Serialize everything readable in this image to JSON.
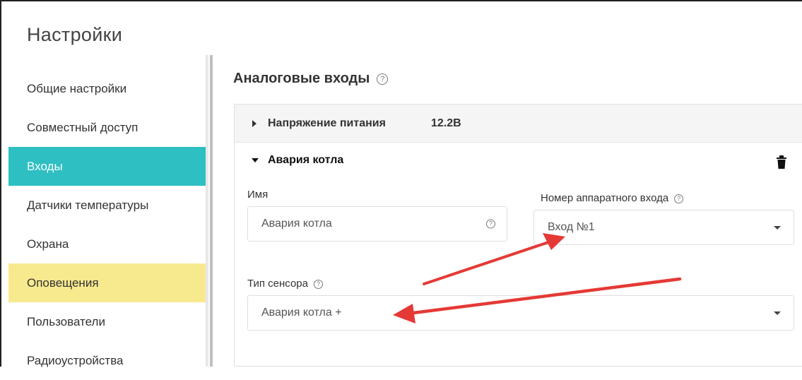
{
  "app": {
    "title": "Настройки"
  },
  "sidebar": {
    "items": [
      {
        "label": "Общие настройки"
      },
      {
        "label": "Совместный доступ"
      },
      {
        "label": "Входы"
      },
      {
        "label": "Датчики температуры"
      },
      {
        "label": "Охрана"
      },
      {
        "label": "Оповещения"
      },
      {
        "label": "Пользователи"
      },
      {
        "label": "Радиоустройства"
      }
    ],
    "active_index": 2,
    "highlight_color": "#2ebfc3",
    "notify_color": "#f7e98e"
  },
  "section": {
    "title": "Аналоговые входы",
    "help_icon": "?"
  },
  "supply": {
    "label": "Напряжение питания",
    "value": "12.2В"
  },
  "input_block": {
    "title": "Авария котла",
    "name_label": "Имя",
    "name_value": "Авария котла",
    "name_help": "?",
    "hw_label": "Номер аппаратного входа",
    "hw_help": "?",
    "hw_value": "Вход №1",
    "sensor_label": "Тип сенсора",
    "sensor_help": "?",
    "sensor_value": "Авария котла +"
  },
  "annotations": {
    "arrow_color": "#e53935"
  }
}
